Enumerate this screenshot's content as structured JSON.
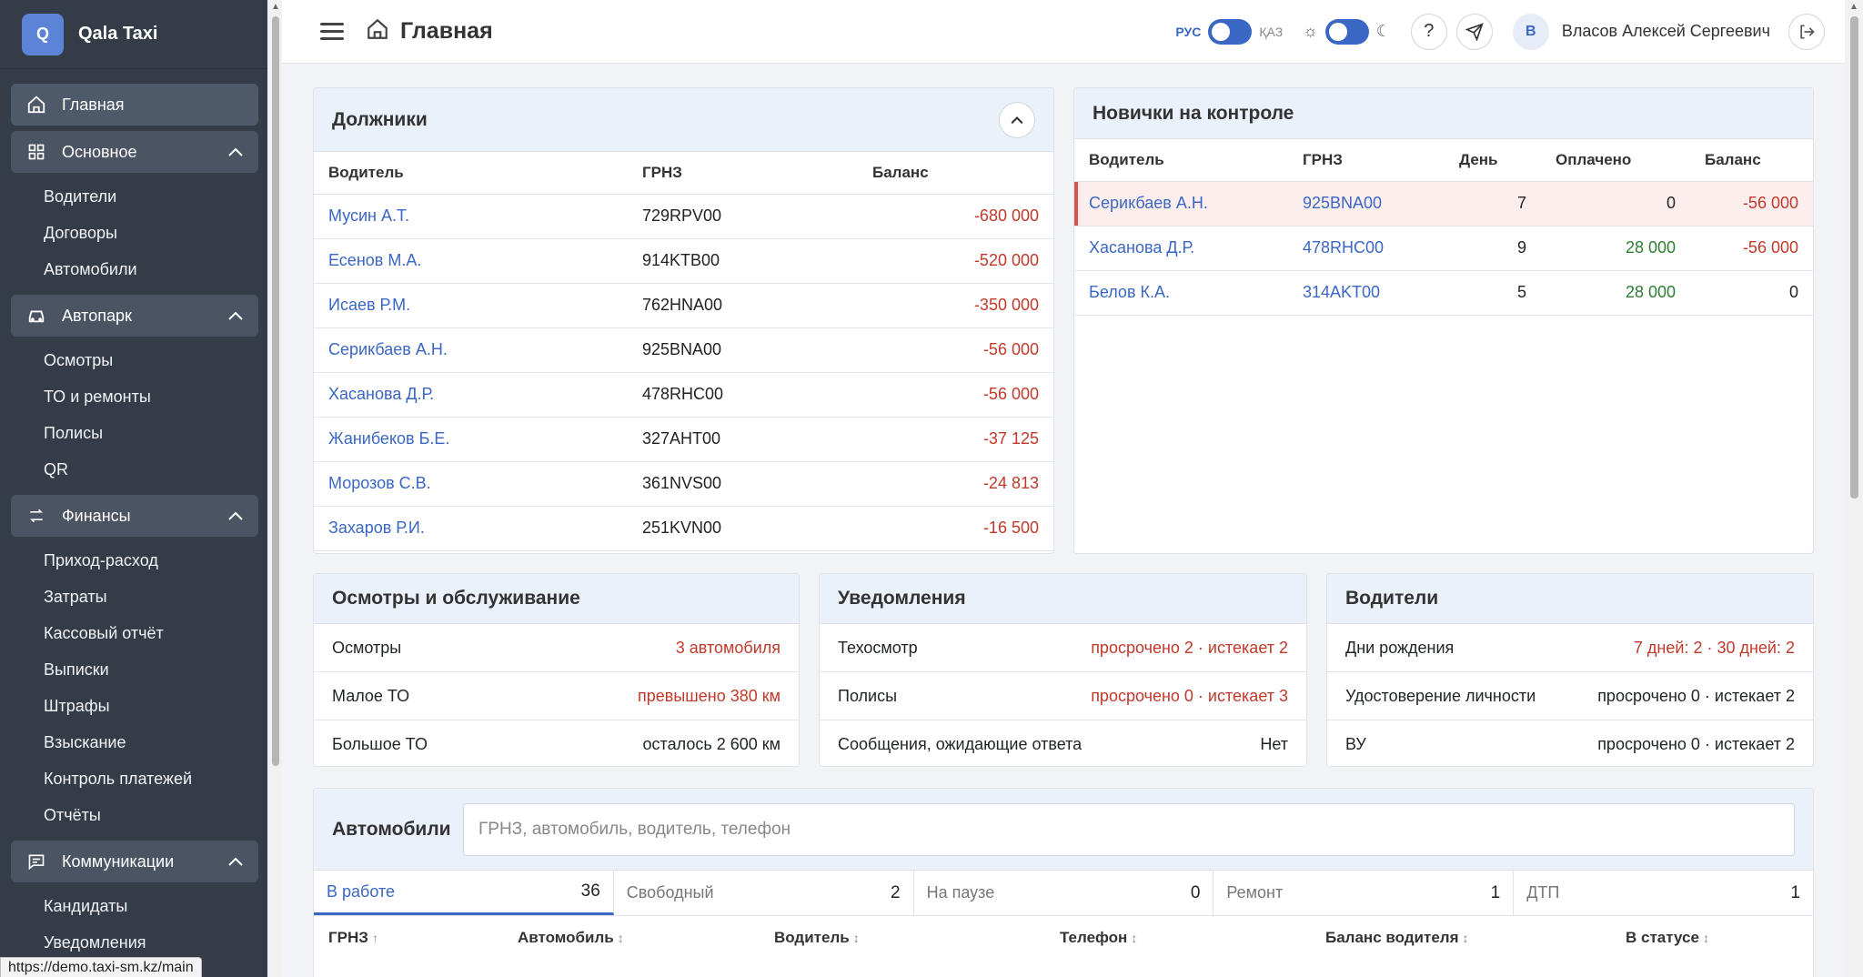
{
  "brand": {
    "logo_letter": "Q",
    "name": "Qala Taxi"
  },
  "sidebar": {
    "home": "Главная",
    "groups": [
      {
        "label": "Основное",
        "icon": "grid-icon",
        "items": [
          "Водители",
          "Договоры",
          "Автомобили"
        ]
      },
      {
        "label": "Автопарк",
        "icon": "car-icon",
        "items": [
          "Осмотры",
          "ТО и ремонты",
          "Полисы",
          "QR"
        ]
      },
      {
        "label": "Финансы",
        "icon": "exchange-icon",
        "items": [
          "Приход-расход",
          "Затраты",
          "Кассовый отчёт",
          "Выписки",
          "Штрафы",
          "Взыскание",
          "Контроль платежей",
          "Отчёты"
        ]
      },
      {
        "label": "Коммуникации",
        "icon": "chat-icon",
        "items": [
          "Кандидаты",
          "Уведомления"
        ]
      }
    ],
    "status_url": "https://demo.taxi-sm.kz/main"
  },
  "header": {
    "title": "Главная",
    "lang_ru": "РУС",
    "lang_kz": "ҚАЗ",
    "user_initial": "В",
    "user_name": "Власов Алексей Сергеевич"
  },
  "debtors": {
    "title": "Должники",
    "columns": [
      "Водитель",
      "ГРНЗ",
      "Баланс"
    ],
    "rows": [
      {
        "driver": "Мусин А.Т.",
        "plate": "729RPV00",
        "balance": "-680 000"
      },
      {
        "driver": "Есенов М.А.",
        "plate": "914KTB00",
        "balance": "-520 000"
      },
      {
        "driver": "Исаев Р.М.",
        "plate": "762HNA00",
        "balance": "-350 000"
      },
      {
        "driver": "Серикбаев А.Н.",
        "plate": "925BNA00",
        "balance": "-56 000"
      },
      {
        "driver": "Хасанова Д.Р.",
        "plate": "478RHC00",
        "balance": "-56 000"
      },
      {
        "driver": "Жанибеков Б.Е.",
        "plate": "327AHT00",
        "balance": "-37 125"
      },
      {
        "driver": "Морозов С.В.",
        "plate": "361NVS00",
        "balance": "-24 813"
      },
      {
        "driver": "Захаров Р.И.",
        "plate": "251KVN00",
        "balance": "-16 500"
      }
    ]
  },
  "newbies": {
    "title": "Новички на контроле",
    "columns": [
      "Водитель",
      "ГРНЗ",
      "День",
      "Оплачено",
      "Баланс"
    ],
    "rows": [
      {
        "driver": "Серикбаев А.Н.",
        "plate": "925BNA00",
        "day": "7",
        "paid": "0",
        "balance": "-56 000"
      },
      {
        "driver": "Хасанова Д.Р.",
        "plate": "478RHC00",
        "day": "9",
        "paid": "28 000",
        "balance": "-56 000"
      },
      {
        "driver": "Белов К.А.",
        "plate": "314AKT00",
        "day": "5",
        "paid": "28 000",
        "balance": "0"
      }
    ]
  },
  "inspections": {
    "title": "Осмотры и обслуживание",
    "rows": [
      {
        "label": "Осмотры",
        "value": "3 автомобиля"
      },
      {
        "label": "Малое ТО",
        "value": "превышено 380 км"
      },
      {
        "label": "Большое ТО",
        "value": "осталось 2 600 км"
      }
    ]
  },
  "notifications": {
    "title": "Уведомления",
    "rows": [
      {
        "label": "Техосмотр",
        "value": "просрочено 2 · истекает 2"
      },
      {
        "label": "Полисы",
        "value": "просрочено 0 · истекает 3"
      },
      {
        "label": "Сообщения, ожидающие ответа",
        "value": "Нет"
      }
    ]
  },
  "drivers": {
    "title": "Водители",
    "rows": [
      {
        "label": "Дни рождения",
        "value": "7 дней: 2 · 30 дней: 2"
      },
      {
        "label": "Удостоверение личности",
        "value": "просрочено 0 · истекает 2"
      },
      {
        "label": "ВУ",
        "value": "просрочено 0 · истекает 2"
      }
    ]
  },
  "cars": {
    "title": "Автомобили",
    "search_placeholder": "ГРНЗ, автомобиль, водитель, телефон",
    "tabs": [
      {
        "label": "В работе",
        "count": "36"
      },
      {
        "label": "Свободный",
        "count": "2"
      },
      {
        "label": "На паузе",
        "count": "0"
      },
      {
        "label": "Ремонт",
        "count": "1"
      },
      {
        "label": "ДТП",
        "count": "1"
      }
    ],
    "columns": [
      {
        "label": "ГРНЗ",
        "sort": "↑"
      },
      {
        "label": "Автомобиль",
        "sort": "↕"
      },
      {
        "label": "Водитель",
        "sort": "↕"
      },
      {
        "label": "Телефон",
        "sort": "↕"
      },
      {
        "label": "Баланс водителя",
        "sort": "↕"
      },
      {
        "label": "В статусе",
        "sort": "↕"
      }
    ]
  },
  "colors": {
    "accent": "#3a66c4",
    "sidebar_bg": "#343c47",
    "negative": "#c0392b",
    "positive": "#2e7d32"
  }
}
